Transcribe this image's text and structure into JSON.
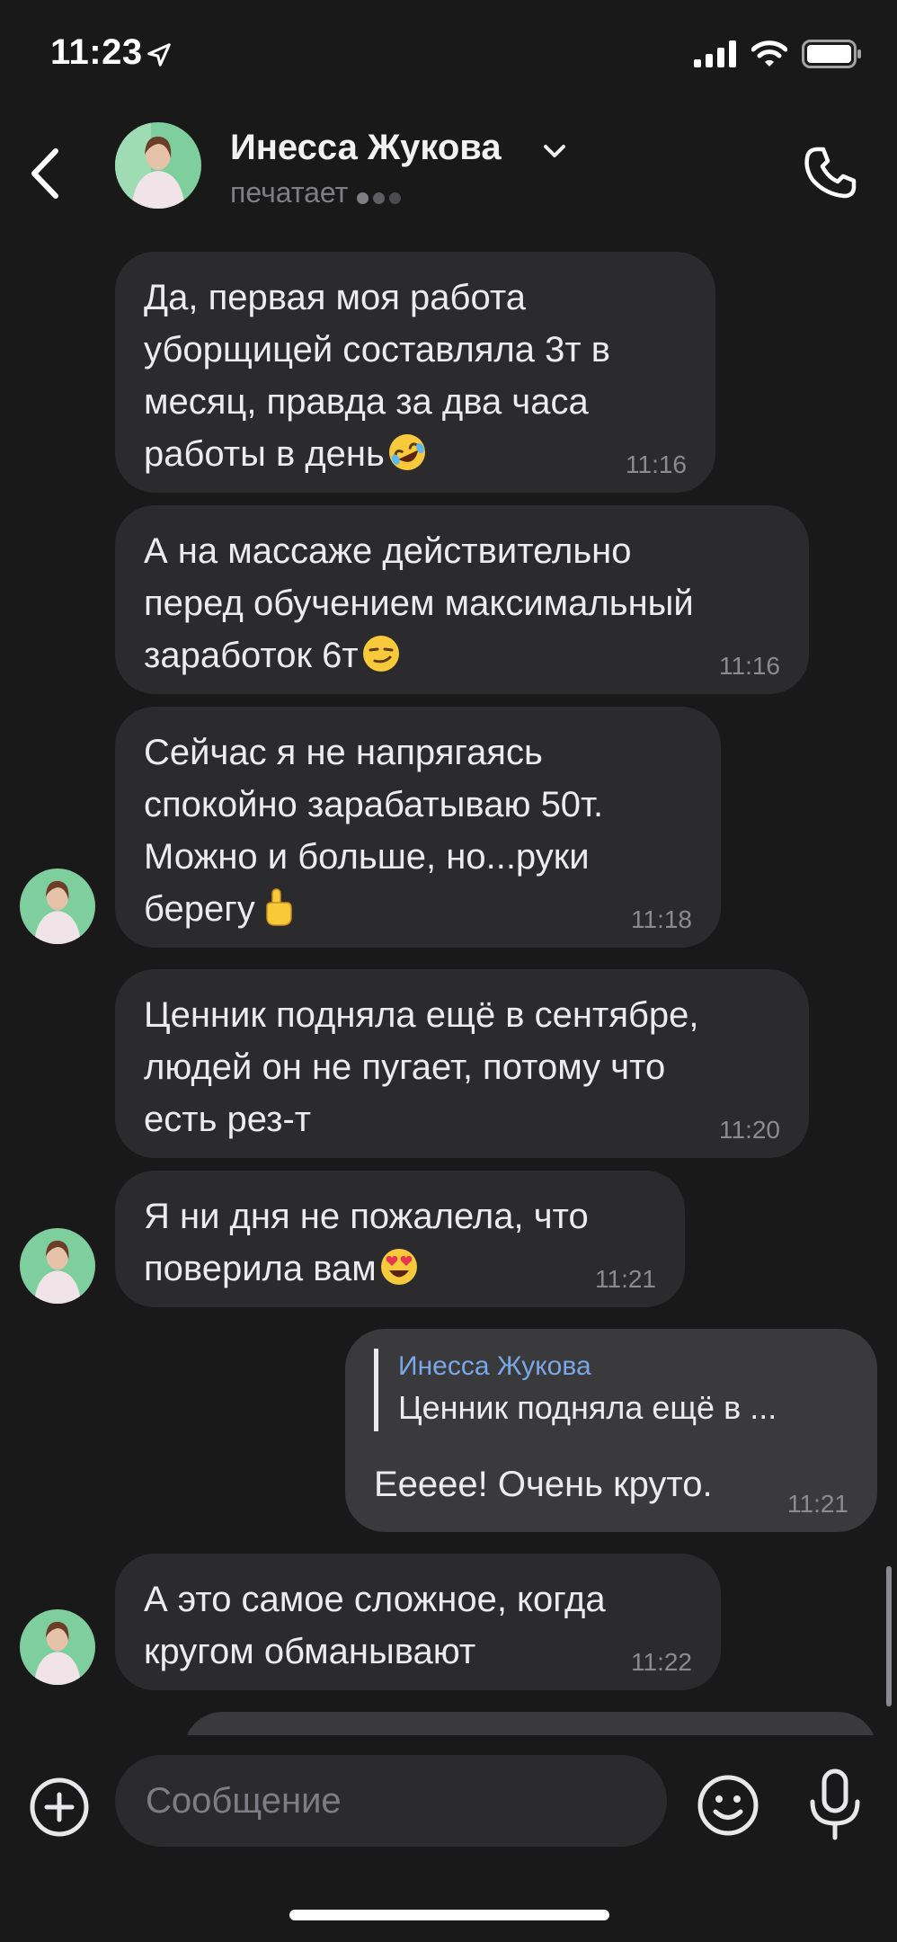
{
  "status_bar": {
    "time": "11:23"
  },
  "header": {
    "contact_name": "Инесса Жукова",
    "status": "печатает"
  },
  "messages": [
    {
      "lines": [
        "Да, первая моя работа",
        "уборщицей составляла 3т в",
        "месяц, правда за два часа",
        "работы в день"
      ],
      "emoji": "rofl-emoji",
      "time": "11:16"
    },
    {
      "lines": [
        "А на массаже действительно",
        "перед обучением максимальный",
        "заработок 6т"
      ],
      "emoji": "smirk-emoji",
      "time": "11:16"
    },
    {
      "lines": [
        "Сейчас я не напрягаясь",
        "спокойно зарабатываю 50т.",
        "Можно и больше, но...руки",
        "берегу"
      ],
      "emoji": "index-up-emoji",
      "time": "11:18"
    },
    {
      "lines": [
        "Ценник подняла ещё в сентябре,",
        "людей он не пугает, потому что",
        "есть рез-т"
      ],
      "time": "11:20"
    },
    {
      "lines": [
        "Я ни дня не пожалела, что",
        "поверила вам"
      ],
      "emoji": "heart-eyes-emoji",
      "time": "11:21"
    },
    {
      "outgoing": true,
      "reply_to_name": "Инесса Жукова",
      "reply_to_text": "Ценник подняла ещё в ...",
      "lines": [
        "Eeeee! Очень круто."
      ],
      "time": "11:21"
    },
    {
      "lines": [
        "А это самое сложное, когда",
        "кругом обманывают"
      ],
      "time": "11:22"
    }
  ],
  "composer": {
    "placeholder": "Сообщение"
  },
  "colors": {
    "background": "#19191a",
    "incoming_bubble": "#2b2b2e",
    "outgoing_bubble": "#3a3a3d",
    "reply_name": "#7aa7e6"
  }
}
